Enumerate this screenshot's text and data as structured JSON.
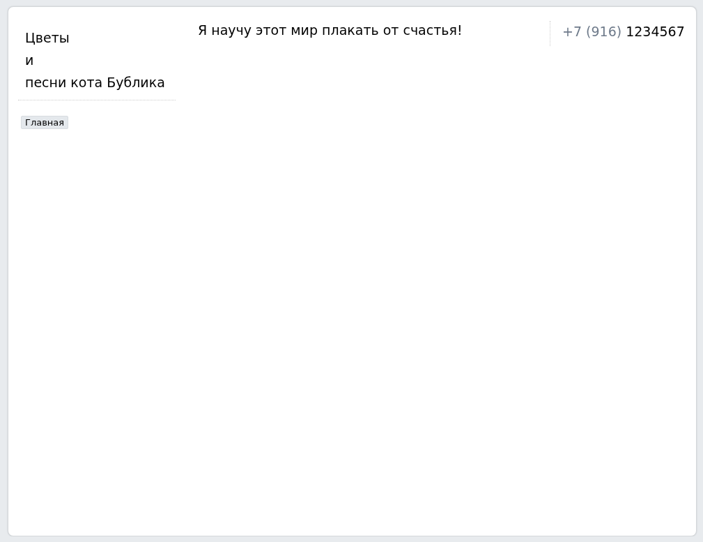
{
  "site_title": {
    "lines": [
      "Цветы",
      "и",
      "песни кота Бублика"
    ]
  },
  "slogan": "Я научу этот мир плакать от счастья!",
  "phone": {
    "code": "+7 (916)",
    "number": "1234567"
  },
  "nav": [
    {
      "label": "Главная",
      "selected": true
    }
  ]
}
